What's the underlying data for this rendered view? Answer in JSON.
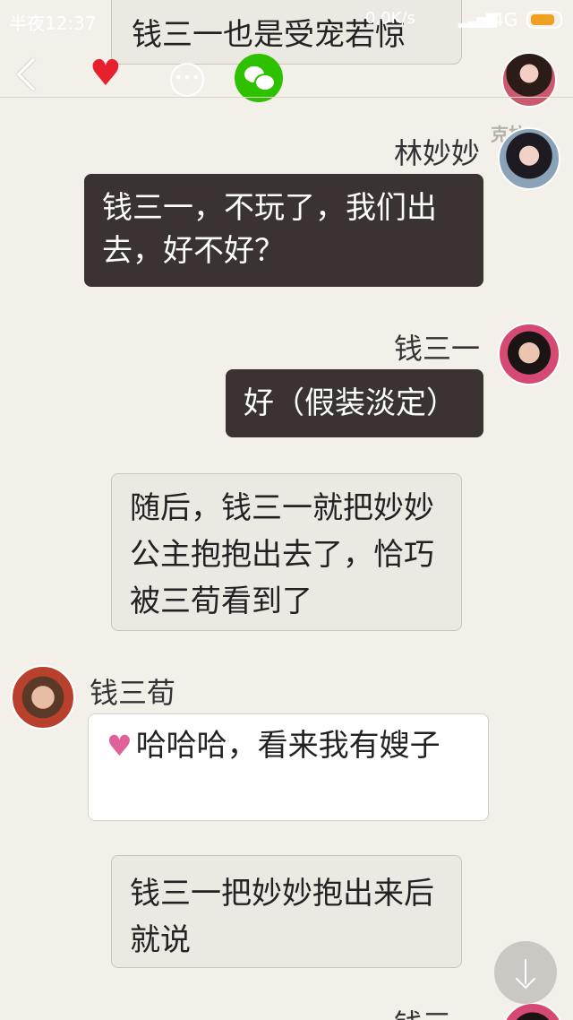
{
  "status_bar": {
    "time": "半夜12:37",
    "speed": "0.0K/s",
    "network": "4G"
  },
  "messages": [
    {
      "type": "narration",
      "text": "钱三一也是受宠若惊"
    },
    {
      "type": "right",
      "sender": "林妙妙",
      "text": "钱三一，不玩了，我们出去，好不好？"
    },
    {
      "type": "right",
      "sender": "钱三一",
      "text": "好（假装淡定）"
    },
    {
      "type": "narration",
      "text": "随后，钱三一就把妙妙公主抱抱出去了，恰巧被三荀看到了"
    },
    {
      "type": "left",
      "sender": "钱三荀",
      "text": "哈哈哈，看来我有嫂子"
    },
    {
      "type": "narration",
      "text": "钱三一把妙妙抱出来后就说"
    },
    {
      "type": "right",
      "sender": "钱三一",
      "text": ""
    }
  ],
  "watermark": "克拉",
  "colors": {
    "background": "#f3f0e9",
    "dark_bubble": "#3a3332",
    "heart": "#e81f2d",
    "wechat": "#2dc100"
  }
}
